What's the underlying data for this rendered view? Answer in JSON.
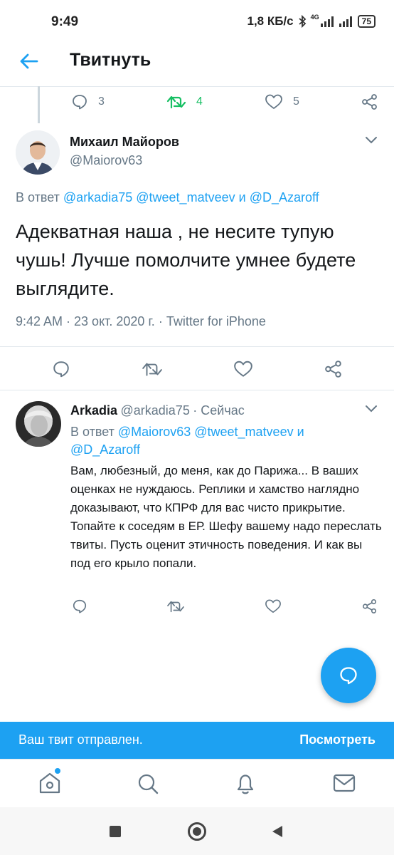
{
  "status_bar": {
    "time": "9:49",
    "net_speed": "1,8 КБ/с",
    "network": "4G",
    "battery": "75"
  },
  "header": {
    "title": "Твитнуть"
  },
  "prev_tweet": {
    "replies": "3",
    "retweets": "4",
    "likes": "5"
  },
  "main_tweet": {
    "name": "Михаил Майоров",
    "handle": "@Maiorov63",
    "reply_prefix": "В ответ",
    "mentions": [
      "@arkadia75",
      "@tweet_matveev",
      "@D_Azaroff"
    ],
    "and_word": "и",
    "text": "Адекватная наша , не несите тупую чушь! Лучше помолчите умнее будете выглядите.",
    "timestamp": "9:42 AM · 23 окт. 2020 г. · ",
    "source": "Twitter for iPhone"
  },
  "reply_tweet": {
    "name": "Arkadia",
    "handle": "@arkadia75",
    "time": "· Сейчас",
    "reply_prefix": "В ответ",
    "mentions": [
      "@Maiorov63",
      "@tweet_matveev",
      "@D_Azaroff"
    ],
    "and_word": "и",
    "text": "Вам, любезный, до меня, как до Парижа... В ваших оценках не нуждаюсь. Реплики и хамство наглядно доказывают, что КПРФ для вас чисто прикрытие. Топайте к соседям в ЕР. Шефу вашему надо переслать твиты. Пусть оценит этичность поведения. И как вы под его крыло попали."
  },
  "toast": {
    "message": "Ваш твит отправлен.",
    "action": "Посмотреть"
  },
  "colors": {
    "accent": "#1da1f2",
    "retweet_green": "#17bf63",
    "muted": "#657786"
  }
}
